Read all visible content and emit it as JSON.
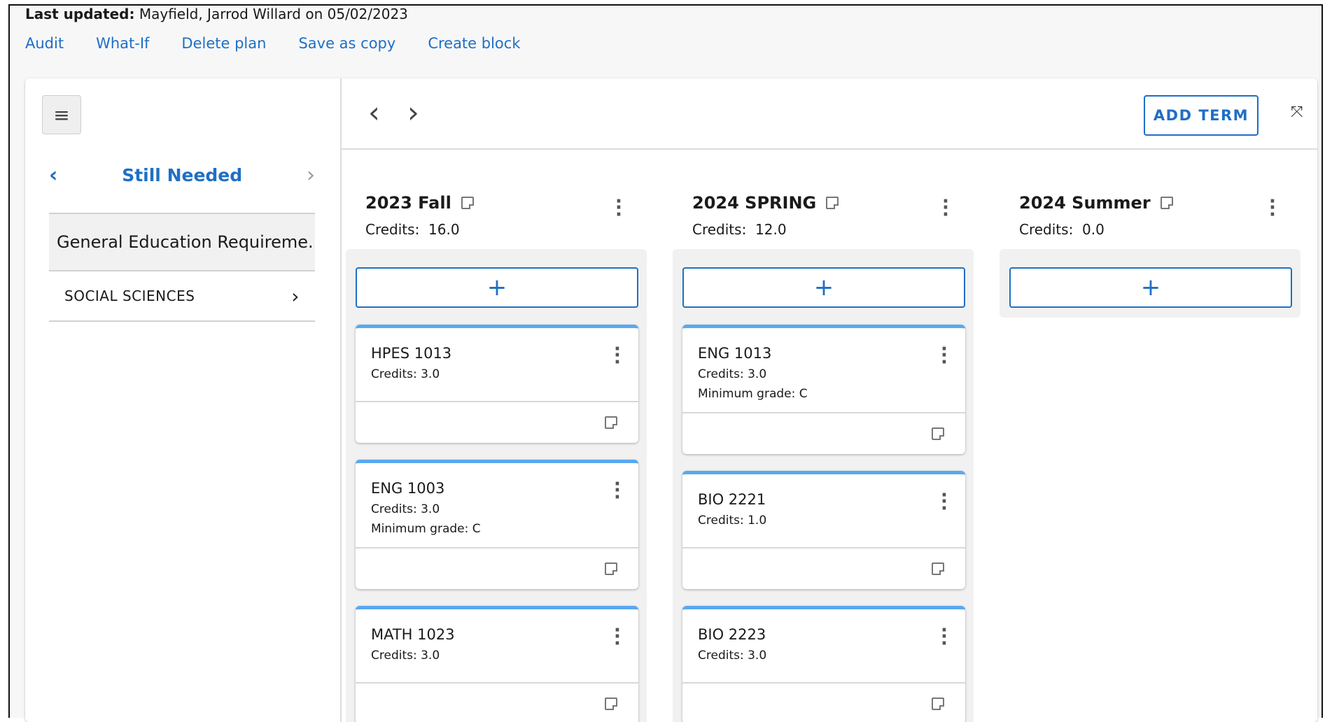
{
  "header": {
    "last_updated_label": "Last updated:",
    "last_updated_value": "Mayfield, Jarrod Willard on 05/02/2023",
    "actions": [
      "Audit",
      "What-If",
      "Delete plan",
      "Save as copy",
      "Create block"
    ]
  },
  "sidebar": {
    "menu_icon": "hamburger-icon",
    "title": "Still Needed",
    "group_label": "General Education Requireme...",
    "item_label": "SOCIAL SCIENCES"
  },
  "toolbar": {
    "add_term_label": "ADD TERM",
    "expand_icon": "expand-icon"
  },
  "terms": [
    {
      "title": "2023 Fall",
      "credits_label": "Credits:",
      "credits": "16.0",
      "courses": [
        {
          "code": "HPES 1013",
          "credits": "Credits: 3.0",
          "grade": ""
        },
        {
          "code": "ENG 1003",
          "credits": "Credits: 3.0",
          "grade": "Minimum grade: C"
        },
        {
          "code": "MATH 1023",
          "credits": "Credits: 3.0",
          "grade": ""
        }
      ]
    },
    {
      "title": "2024 SPRING",
      "credits_label": "Credits:",
      "credits": "12.0",
      "courses": [
        {
          "code": "ENG 1013",
          "credits": "Credits: 3.0",
          "grade": "Minimum grade: C"
        },
        {
          "code": "BIO 2221",
          "credits": "Credits: 1.0",
          "grade": ""
        },
        {
          "code": "BIO 2223",
          "credits": "Credits: 3.0",
          "grade": ""
        }
      ]
    },
    {
      "title": "2024 Summer",
      "credits_label": "Credits:",
      "credits": "0.0",
      "courses": []
    }
  ],
  "colors": {
    "accent": "#1f6fc5",
    "card_top_border": "#5aa8f0",
    "term_bg": "#f1f1f1"
  }
}
